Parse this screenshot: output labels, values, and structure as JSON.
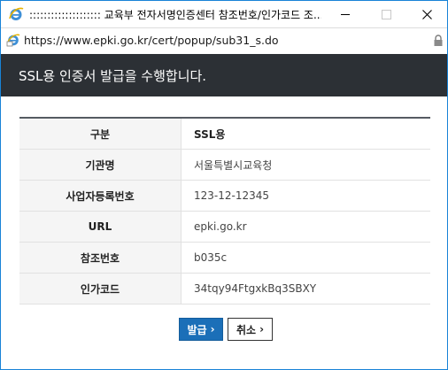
{
  "window": {
    "title": ":::::::::::::::::::: 교육부 전자서명인증센터 참조번호/인가코드 조...",
    "url": "https://www.epki.go.kr/cert/popup/sub31_s.do"
  },
  "banner": {
    "title": "SSL용 인증서 발급을 수행합니다."
  },
  "table": {
    "rows": [
      {
        "label": "구분",
        "value": "SSL용"
      },
      {
        "label": "기관명",
        "value": "서울특별시교육청"
      },
      {
        "label": "사업자등록번호",
        "value": "123-12-12345"
      },
      {
        "label": "URL",
        "value": "epki.go.kr"
      },
      {
        "label": "참조번호",
        "value": "b035c"
      },
      {
        "label": "인가코드",
        "value": "34tqy94FtgxkBq3SBXY"
      }
    ]
  },
  "buttons": {
    "issue": "발급",
    "cancel": "취소",
    "chevron": "›"
  },
  "colors": {
    "banner_bg": "#2c3035",
    "issue_button": "#1b6fb8",
    "window_border": "#1883d7"
  }
}
